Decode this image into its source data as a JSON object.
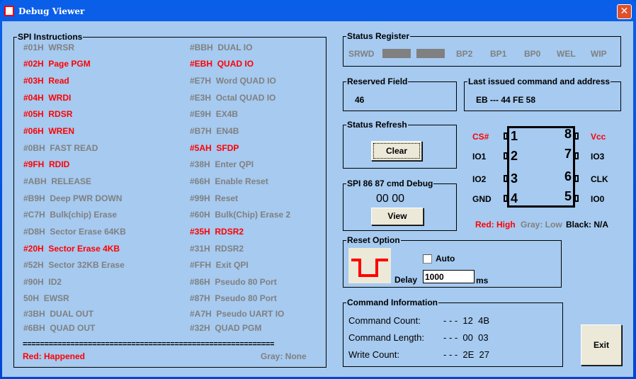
{
  "window": {
    "title": "Debug Viewer",
    "close_icon": "close-icon"
  },
  "spi": {
    "legend": "SPI Instructions",
    "left": [
      {
        "code": "#01H",
        "name": "WRSR",
        "state": "gray"
      },
      {
        "code": "#02H",
        "name": "Page PGM",
        "state": "red"
      },
      {
        "code": "#03H",
        "name": "Read",
        "state": "red"
      },
      {
        "code": "#04H",
        "name": "WRDI",
        "state": "red"
      },
      {
        "code": "#05H",
        "name": "RDSR",
        "state": "red"
      },
      {
        "code": "#06H",
        "name": "WREN",
        "state": "red"
      },
      {
        "code": "#0BH",
        "name": "FAST READ",
        "state": "gray"
      },
      {
        "code": "#9FH",
        "name": "RDID",
        "state": "red"
      },
      {
        "code": "#ABH",
        "name": "RELEASE",
        "state": "gray"
      },
      {
        "code": "#B9H",
        "name": "Deep PWR DOWN",
        "state": "gray"
      },
      {
        "code": "#C7H",
        "name": "Bulk(chip) Erase",
        "state": "gray"
      },
      {
        "code": "#D8H",
        "name": "Sector Erase 64KB",
        "state": "gray"
      },
      {
        "code": "#20H",
        "name": "Sector Erase 4KB",
        "state": "red"
      },
      {
        "code": "#52H",
        "name": "Sector 32KB Erase",
        "state": "gray"
      },
      {
        "code": "#90H",
        "name": "ID2",
        "state": "gray"
      },
      {
        "code": "50H",
        "name": "EWSR",
        "state": "gray"
      },
      {
        "code": "#3BH",
        "name": "DUAL OUT",
        "state": "gray"
      },
      {
        "code": "#6BH",
        "name": "QUAD OUT",
        "state": "gray"
      }
    ],
    "right": [
      {
        "code": "#BBH",
        "name": "DUAL IO",
        "state": "gray"
      },
      {
        "code": "#EBH",
        "name": "QUAD IO",
        "state": "red"
      },
      {
        "code": "#E7H",
        "name": "Word QUAD IO",
        "state": "gray"
      },
      {
        "code": "#E3H",
        "name": "Octal QUAD IO",
        "state": "gray"
      },
      {
        "code": "#E9H",
        "name": "EX4B",
        "state": "gray"
      },
      {
        "code": "#B7H",
        "name": "EN4B",
        "state": "gray"
      },
      {
        "code": "#5AH",
        "name": "SFDP",
        "state": "red"
      },
      {
        "code": "#38H",
        "name": "Enter QPI",
        "state": "gray"
      },
      {
        "code": "#66H",
        "name": "Enable Reset",
        "state": "gray"
      },
      {
        "code": "#99H",
        "name": "Reset",
        "state": "gray"
      },
      {
        "code": "#60H",
        "name": "Bulk(Chip) Erase 2",
        "state": "gray"
      },
      {
        "code": "#35H",
        "name": "RDSR2",
        "state": "red"
      },
      {
        "code": "#31H",
        "name": "RDSR2",
        "state": "gray"
      },
      {
        "code": "#FFH",
        "name": "Exit QPI",
        "state": "gray"
      },
      {
        "code": "#86H",
        "name": "Pseudo 80 Port",
        "state": "gray"
      },
      {
        "code": "#87H",
        "name": "Pseudo 80 Port",
        "state": "gray"
      },
      {
        "code": "#A7H",
        "name": "Pseudo UART IO",
        "state": "gray"
      },
      {
        "code": "#32H",
        "name": "QUAD PGM",
        "state": "gray"
      }
    ],
    "separator": "==========================================================",
    "legend_red": "Red: Happened",
    "legend_gray": "Gray: None"
  },
  "status_register": {
    "legend": "Status Register",
    "bits": [
      "SRWD",
      "",
      "",
      "BP2",
      "BP1",
      "BP0",
      "WEL",
      "WIP"
    ]
  },
  "reserved": {
    "legend": "Reserved Field",
    "value": "46"
  },
  "last_cmd": {
    "legend": "Last  issued command and address",
    "value": "EB --- 44 FE 58"
  },
  "refresh": {
    "legend": "Status Refresh",
    "clear": "Clear"
  },
  "spi_debug": {
    "legend": "SPI 86 87 cmd Debug",
    "value": "00  00",
    "view": "View"
  },
  "chip": {
    "pins_left": [
      {
        "num": "1",
        "label": "CS#",
        "state": "red"
      },
      {
        "num": "2",
        "label": "IO1",
        "state": "black"
      },
      {
        "num": "3",
        "label": "IO2",
        "state": "black"
      },
      {
        "num": "4",
        "label": "GND",
        "state": "black"
      }
    ],
    "pins_right": [
      {
        "num": "8",
        "label": "Vcc",
        "state": "red"
      },
      {
        "num": "7",
        "label": "IO3",
        "state": "black"
      },
      {
        "num": "6",
        "label": "CLK",
        "state": "black"
      },
      {
        "num": "5",
        "label": "IO0",
        "state": "black"
      }
    ],
    "legend_red": "Red: High",
    "legend_gray": "Gray: Low",
    "legend_black": "Black: N/A"
  },
  "reset": {
    "legend": "Reset Option",
    "auto_label": "Auto",
    "auto_checked": false,
    "delay_label": "Delay",
    "delay_value": "1000",
    "unit": "ms",
    "waveform_icon": "reset-pulse-icon"
  },
  "cmd_info": {
    "legend": "Command Information",
    "rows": [
      {
        "label": "Command Count:",
        "value": "- - -  12  4B"
      },
      {
        "label": "Command Length:",
        "value": "- - -  00  03"
      },
      {
        "label": "Write Count:",
        "value": "- - -  2E  27"
      }
    ]
  },
  "exit": "Exit",
  "colors": {
    "high": "#FF0000",
    "low": "#808080",
    "background": "#A6CAF0",
    "titlebar": "#0054E3"
  }
}
